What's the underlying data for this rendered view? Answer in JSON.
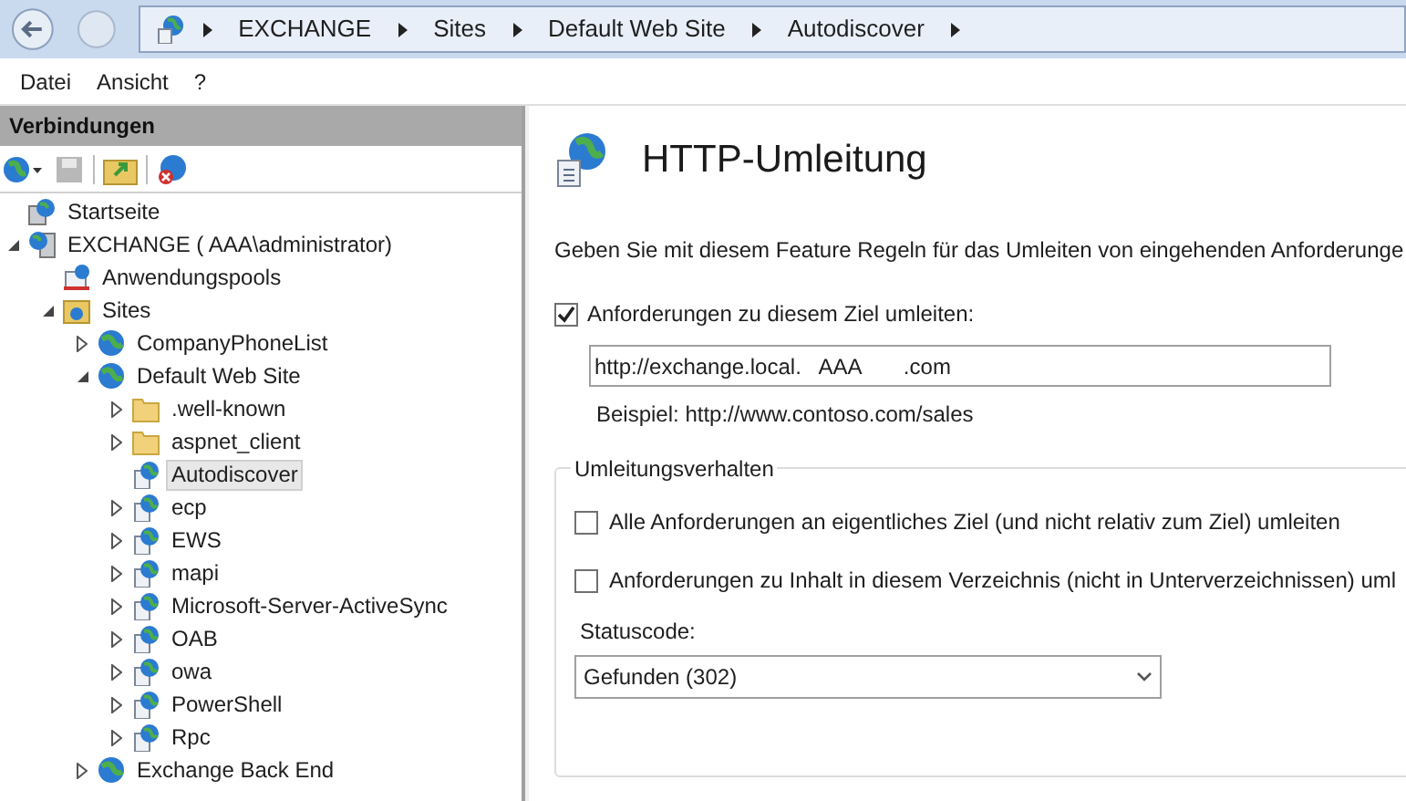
{
  "breadcrumb": [
    "EXCHANGE",
    "Sites",
    "Default Web Site",
    "Autodiscover"
  ],
  "menu": [
    "Datei",
    "Ansicht",
    "?"
  ],
  "connections": {
    "title": "Verbindungen",
    "tree": [
      {
        "label": "Startseite",
        "kind": "home",
        "selected": false
      },
      {
        "label": "EXCHANGE ( AAA\\administrator)",
        "kind": "server",
        "selected": false,
        "expanded": true,
        "children": [
          {
            "label": "Anwendungspools",
            "kind": "apppool",
            "selected": false
          },
          {
            "label": "Sites",
            "kind": "sites",
            "selected": false,
            "expanded": true,
            "children": [
              {
                "label": "CompanyPhoneList",
                "kind": "globe",
                "selected": false,
                "expanded": false
              },
              {
                "label": "Default Web Site",
                "kind": "globe",
                "selected": false,
                "expanded": true,
                "children": [
                  {
                    "label": ".well-known",
                    "kind": "folder",
                    "selected": false,
                    "expanded": false
                  },
                  {
                    "label": "aspnet_client",
                    "kind": "folder",
                    "selected": false,
                    "expanded": false
                  },
                  {
                    "label": "Autodiscover",
                    "kind": "app",
                    "selected": true
                  },
                  {
                    "label": "ecp",
                    "kind": "app",
                    "selected": false,
                    "expanded": false
                  },
                  {
                    "label": "EWS",
                    "kind": "app",
                    "selected": false,
                    "expanded": false
                  },
                  {
                    "label": "mapi",
                    "kind": "app",
                    "selected": false,
                    "expanded": false
                  },
                  {
                    "label": "Microsoft-Server-ActiveSync",
                    "kind": "app",
                    "selected": false,
                    "expanded": false
                  },
                  {
                    "label": "OAB",
                    "kind": "app",
                    "selected": false,
                    "expanded": false
                  },
                  {
                    "label": "owa",
                    "kind": "app",
                    "selected": false,
                    "expanded": false
                  },
                  {
                    "label": "PowerShell",
                    "kind": "app",
                    "selected": false,
                    "expanded": false
                  },
                  {
                    "label": "Rpc",
                    "kind": "app",
                    "selected": false,
                    "expanded": false
                  }
                ]
              },
              {
                "label": "Exchange Back End",
                "kind": "globe",
                "selected": false,
                "expanded": false
              }
            ]
          }
        ]
      }
    ]
  },
  "feature": {
    "title": "HTTP-Umleitung",
    "description": "Geben Sie mit diesem Feature Regeln für das Umleiten von eingehenden Anforderunge",
    "redirect": {
      "label": "Anforderungen zu diesem Ziel umleiten:",
      "checked": true,
      "value": "http://exchange.local.   AAA       .com",
      "example": "Beispiel: http://www.contoso.com/sales"
    },
    "behavior": {
      "title": "Umleitungsverhalten",
      "options": [
        {
          "label": "Alle Anforderungen an eigentliches Ziel (und nicht relativ zum Ziel) umleiten",
          "checked": false
        },
        {
          "label": "Anforderungen zu Inhalt in diesem Verzeichnis (nicht in Unterverzeichnissen) uml",
          "checked": false
        }
      ],
      "status_label": "Statuscode:",
      "status_value": "Gefunden (302)"
    }
  }
}
